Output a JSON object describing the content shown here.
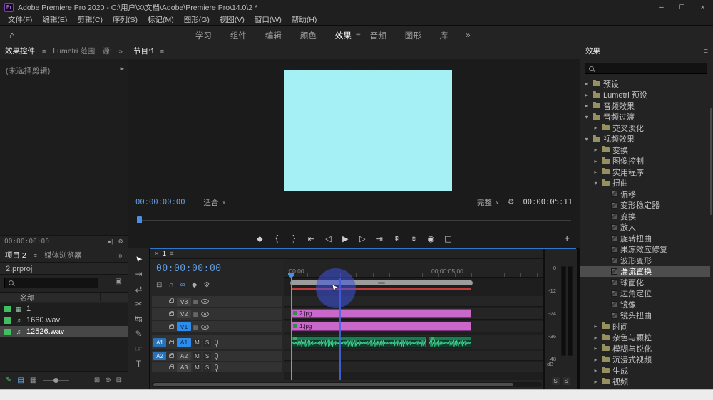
{
  "colors": {
    "accent_blue": "#2d8ceb",
    "timecode_blue": "#5f9fe8",
    "clip_pink": "#ca67ca",
    "audio_waveform_green": "#3ed18c",
    "render_bar_red": "#c23c3c",
    "preview_cyan": "#9ff0f4",
    "label_green": "#3fbf5f"
  },
  "icons": {
    "home": "⌂",
    "menu": "≡",
    "overflow": "»",
    "chevron_right": "▸",
    "chevron_down": "▾",
    "caret": "∨",
    "close": "×",
    "wrench": "⚙",
    "plus": "+",
    "sequence": "▦",
    "audio": "♫",
    "sync": "▤",
    "panel_options": "▣",
    "cursor": "➤"
  },
  "window": {
    "title": "Adobe Premiere Pro 2020 - C:\\用户\\X\\文档\\Adobe\\Premiere Pro\\14.0\\2 *",
    "controls": [
      {
        "name": "minimize-button",
        "glyph": "─"
      },
      {
        "name": "maximize-button",
        "glyph": "☐"
      },
      {
        "name": "close-button",
        "glyph": "×"
      }
    ]
  },
  "menu_bar": {
    "items": [
      "文件(F)",
      "编辑(E)",
      "剪辑(C)",
      "序列(S)",
      "标记(M)",
      "图形(G)",
      "视图(V)",
      "窗口(W)",
      "帮助(H)"
    ]
  },
  "workspace_bar": {
    "tabs": [
      {
        "label": "学习"
      },
      {
        "label": "组件"
      },
      {
        "label": "编辑"
      },
      {
        "label": "颜色"
      },
      {
        "label": "效果",
        "active": true
      },
      {
        "label": "音频"
      },
      {
        "label": "图形"
      },
      {
        "label": "库"
      }
    ],
    "overflow": "»"
  },
  "effect_controls": {
    "tabs": [
      {
        "label": "效果控件",
        "active": true
      },
      {
        "label": "Lumetri 范围"
      },
      {
        "label": "源:"
      }
    ],
    "empty_message": "(未选择剪辑)",
    "timecode": "00:00:00:00",
    "footer_icons": [
      {
        "name": "play-in-to-out-icon",
        "glyph": "▸|"
      },
      {
        "name": "settings-wrench-icon",
        "glyph": "⚙"
      }
    ]
  },
  "program_monitor": {
    "tab": "节目:1",
    "timecode": "00:00:00:00",
    "zoom_select": "适合",
    "resolution_select": "完整",
    "duration": "00:00:05:11",
    "transport": [
      {
        "name": "add-marker-button",
        "glyph": "◆"
      },
      {
        "name": "mark-in-button",
        "glyph": "{"
      },
      {
        "name": "mark-out-button",
        "glyph": "}"
      },
      {
        "name": "go-to-in-button",
        "glyph": "⇤"
      },
      {
        "name": "step-back-button",
        "glyph": "◁"
      },
      {
        "name": "play-button",
        "glyph": "▶"
      },
      {
        "name": "step-forward-button",
        "glyph": "▷"
      },
      {
        "name": "go-to-out-button",
        "glyph": "⇥"
      },
      {
        "name": "lift-button",
        "glyph": "⇞"
      },
      {
        "name": "extract-button",
        "glyph": "⇟"
      },
      {
        "name": "export-frame-button",
        "glyph": "◉"
      },
      {
        "name": "comparison-view-button",
        "glyph": "◫"
      }
    ],
    "add_button": "+"
  },
  "tools": [
    {
      "name": "selection-tool",
      "glyph": "➤",
      "active": true
    },
    {
      "name": "track-select-forward-tool",
      "glyph": "⇥"
    },
    {
      "name": "ripple-edit-tool",
      "glyph": "⇄"
    },
    {
      "name": "razor-tool",
      "glyph": "✂"
    },
    {
      "name": "slip-tool",
      "glyph": "↹"
    },
    {
      "name": "pen-tool",
      "glyph": "✎"
    },
    {
      "name": "hand-tool",
      "glyph": "☞"
    },
    {
      "name": "type-tool",
      "glyph": "T"
    }
  ],
  "project_panel": {
    "tabs": [
      {
        "label": "项目:2",
        "active": true
      },
      {
        "label": "媒体浏览器"
      }
    ],
    "bin_path": "2.prproj",
    "column_header": "名称",
    "items": [
      {
        "label": "1",
        "type": "sequence"
      },
      {
        "label": "1660.wav",
        "type": "audio"
      },
      {
        "label": "12526.wav",
        "type": "audio",
        "selected": true
      }
    ],
    "footer_left": [
      {
        "name": "project-writable-icon",
        "glyph": "✎",
        "style": "green"
      },
      {
        "name": "list-view-icon",
        "glyph": "▤",
        "style": "active"
      },
      {
        "name": "icon-view-icon",
        "glyph": "▦",
        "style": ""
      }
    ],
    "footer_right": [
      {
        "name": "new-bin-icon",
        "glyph": "⊞"
      },
      {
        "name": "new-item-icon",
        "glyph": "⊕"
      },
      {
        "name": "delete-icon",
        "glyph": "⊟"
      }
    ]
  },
  "timeline": {
    "tab_label": "1",
    "timecode": "00:00:00:00",
    "ruler_labels": [
      ":00:00",
      "00:00:05:00"
    ],
    "toolbar": [
      {
        "name": "nest-toggle-icon",
        "glyph": "⊡"
      },
      {
        "name": "snap-icon",
        "glyph": "∩"
      },
      {
        "name": "linked-selection-icon",
        "glyph": "∞",
        "active": true
      },
      {
        "name": "add-marker-icon",
        "glyph": "◆"
      },
      {
        "name": "timeline-settings-icon",
        "glyph": "⚙"
      }
    ],
    "mute_label": "M",
    "solo_label": "S",
    "video_tracks": [
      {
        "label": "V3",
        "patch": ""
      },
      {
        "label": "V2",
        "patch": "",
        "clip": {
          "name": "2.jpg"
        }
      },
      {
        "label": "V1",
        "patch": "",
        "targeted": true,
        "clip": {
          "name": "1.jpg"
        }
      }
    ],
    "audio_tracks": [
      {
        "label": "A1",
        "patch": "A1",
        "targeted": true,
        "has_audio_clips": true
      },
      {
        "label": "A2",
        "patch": "A2"
      },
      {
        "label": "A3",
        "patch": ""
      }
    ]
  },
  "audio_meter": {
    "scale": [
      "0",
      "-12",
      "-24",
      "-36",
      "-48"
    ],
    "db": "dB",
    "solo_buttons": [
      "S",
      "S"
    ]
  },
  "effects_panel": {
    "title": "效果",
    "tree": [
      {
        "label": "预设",
        "type": "folder",
        "depth": 0,
        "expanded": false
      },
      {
        "label": "Lumetri 预设",
        "type": "folder",
        "depth": 0,
        "expanded": false
      },
      {
        "label": "音频效果",
        "type": "folder",
        "depth": 0,
        "expanded": false
      },
      {
        "label": "音频过渡",
        "type": "folder",
        "depth": 0,
        "expanded": true
      },
      {
        "label": "交叉淡化",
        "type": "folder",
        "depth": 1,
        "expanded": false
      },
      {
        "label": "视频效果",
        "type": "folder",
        "depth": 0,
        "expanded": true
      },
      {
        "label": "变换",
        "type": "folder",
        "depth": 1,
        "expanded": false
      },
      {
        "label": "图像控制",
        "type": "folder",
        "depth": 1,
        "expanded": false
      },
      {
        "label": "实用程序",
        "type": "folder",
        "depth": 1,
        "expanded": false
      },
      {
        "label": "扭曲",
        "type": "folder",
        "depth": 1,
        "expanded": true
      },
      {
        "label": "偏移",
        "type": "effect",
        "depth": 2
      },
      {
        "label": "变形稳定器",
        "type": "effect",
        "depth": 2
      },
      {
        "label": "变换",
        "type": "effect",
        "depth": 2
      },
      {
        "label": "放大",
        "type": "effect",
        "depth": 2
      },
      {
        "label": "旋转扭曲",
        "type": "effect",
        "depth": 2
      },
      {
        "label": "果冻效应修复",
        "type": "effect",
        "depth": 2
      },
      {
        "label": "波形变形",
        "type": "effect",
        "depth": 2
      },
      {
        "label": "湍流置换",
        "type": "effect",
        "depth": 2,
        "selected": true
      },
      {
        "label": "球面化",
        "type": "effect",
        "depth": 2
      },
      {
        "label": "边角定位",
        "type": "effect",
        "depth": 2
      },
      {
        "label": "镜像",
        "type": "effect",
        "depth": 2
      },
      {
        "label": "镜头扭曲",
        "type": "effect",
        "depth": 2
      },
      {
        "label": "时间",
        "type": "folder",
        "depth": 1,
        "expanded": false
      },
      {
        "label": "杂色与颗粒",
        "type": "folder",
        "depth": 1,
        "expanded": false
      },
      {
        "label": "模糊与锐化",
        "type": "folder",
        "depth": 1,
        "expanded": false
      },
      {
        "label": "沉浸式视频",
        "type": "folder",
        "depth": 1,
        "expanded": false
      },
      {
        "label": "生成",
        "type": "folder",
        "depth": 1,
        "expanded": false
      },
      {
        "label": "视频",
        "type": "folder",
        "depth": 1,
        "expanded": false
      }
    ]
  }
}
